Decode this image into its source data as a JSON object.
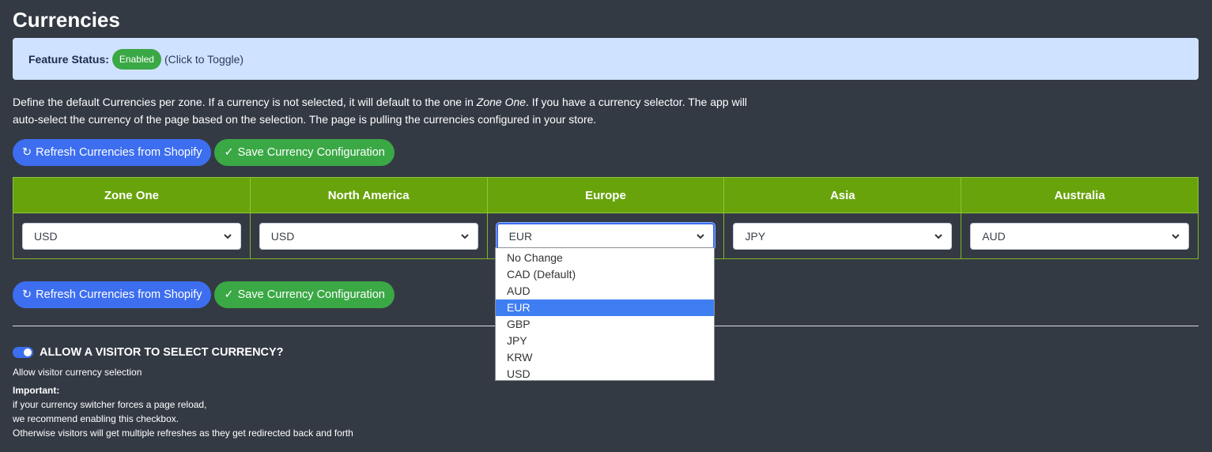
{
  "title": "Currencies",
  "feature_status": {
    "label": "Feature Status:",
    "badge": "Enabled",
    "hint": "(Click to Toggle)"
  },
  "description": {
    "part1": "Define the default Currencies per zone. If a currency is not selected, it will default to the one in ",
    "zone_name": "Zone One",
    "part2": ". If you have a currency selector. The app will auto-select the currency of the page based on the selection. The page is pulling the currencies configured in your store."
  },
  "buttons": {
    "refresh_label": "Refresh Currencies from Shopify",
    "refresh_icon": "↻",
    "save_label": "Save Currency Configuration",
    "save_icon": "✓"
  },
  "table": {
    "headers": [
      "Zone One",
      "North America",
      "Europe",
      "Asia",
      "Australia"
    ],
    "selected": [
      "USD",
      "USD",
      "EUR",
      "JPY",
      "AUD"
    ]
  },
  "dropdown": {
    "options": [
      "No Change",
      "CAD (Default)",
      "AUD",
      "EUR",
      "GBP",
      "JPY",
      "KRW",
      "USD"
    ],
    "highlighted": "EUR"
  },
  "visitor_selection": {
    "toggle_title": "ALLOW A VISITOR TO SELECT CURRENCY?",
    "subtitle": "Allow visitor currency selection",
    "important_label": "Important:",
    "line1": "if your currency switcher forces a page reload,",
    "line2": "we recommend enabling this checkbox.",
    "line3": "Otherwise visitors will get multiple refreshes as they get redirected back and forth"
  },
  "colors": {
    "background": "#343a44",
    "info_box": "#cfe2ff",
    "header_green": "#68a30b",
    "button_blue": "#3d6ef0",
    "button_green": "#3aa845",
    "highlight": "#3f7ef2"
  }
}
